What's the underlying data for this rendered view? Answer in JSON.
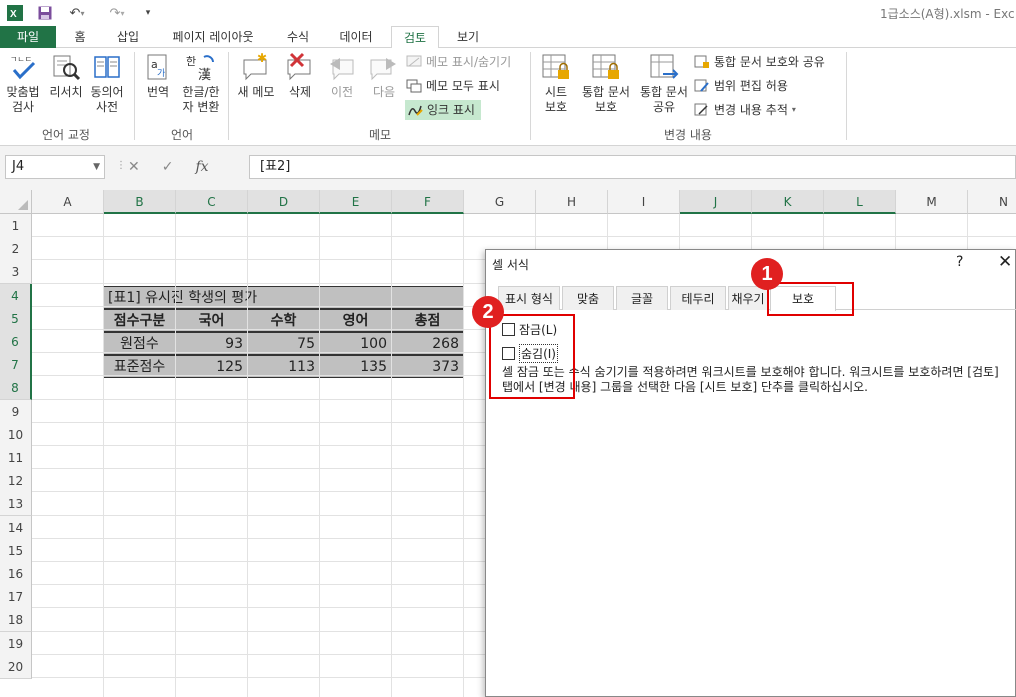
{
  "titlebar": {
    "app_title": "1급소스(A형).xlsm - Exc"
  },
  "tabs": [
    "파일",
    "홈",
    "삽입",
    "페이지 레이아웃",
    "수식",
    "데이터",
    "검토",
    "보기"
  ],
  "ribbon": {
    "language": {
      "spell_1": "맞춤법",
      "spell_2": "검사",
      "research": "리서치",
      "thesaurus_1": "동의어",
      "thesaurus_2": "사전",
      "label": "언어 교정"
    },
    "lang": {
      "translate": "번역",
      "hanja_1": "한글/한",
      "hanja_2": "자 변환",
      "label": "언어"
    },
    "memo": {
      "new": "새 메모",
      "delete": "삭제",
      "prev": "이전",
      "next": "다음",
      "show_hide": "메모 표시/숨기기",
      "show_all": "메모 모두 표시",
      "ink": "잉크 표시",
      "label": "메모"
    },
    "changes": {
      "protect_sheet_1": "시트",
      "protect_sheet_2": "보호",
      "protect_wb_1": "통합 문서",
      "protect_wb_2": "보호",
      "share_wb_1": "통합 문서",
      "share_wb_2": "공유",
      "protect_share": "통합 문서 보호와 공유",
      "allow_edit": "범위 편집 허용",
      "track": "변경 내용 추적",
      "label": "변경 내용"
    }
  },
  "formula_bar": {
    "name_box": "J4",
    "fx": "fx",
    "value": "[표2]"
  },
  "grid": {
    "columns": [
      "A",
      "B",
      "C",
      "D",
      "E",
      "F",
      "G",
      "H",
      "I",
      "J",
      "K",
      "L",
      "M",
      "N"
    ],
    "rows": [
      "1",
      "2",
      "3",
      "4",
      "5",
      "6",
      "7",
      "8",
      "9",
      "10",
      "11",
      "12",
      "13",
      "14",
      "15",
      "16",
      "17",
      "18",
      "19",
      "20"
    ]
  },
  "table": {
    "title": "[표1] 유시진 학생의 평가",
    "headers": [
      "점수구분",
      "국어",
      "수학",
      "영어",
      "총점"
    ],
    "rows": [
      [
        "원점수",
        "93",
        "75",
        "100",
        "268"
      ],
      [
        "표준점수",
        "125",
        "113",
        "135",
        "373"
      ]
    ]
  },
  "dialog": {
    "title": "셀 서식",
    "help": "?",
    "close": "✕",
    "tabs": [
      "표시 형식",
      "맞춤",
      "글꼴",
      "테두리",
      "채우기",
      "보호"
    ],
    "lock_label": "잠금(L)",
    "hide_label": "숨김(I)",
    "note": "셀 잠금 또는 수식 숨기기를 적용하려면 워크시트를 보호해야 합니다. 워크시트를 보호하려면 [검토] 탭에서 [변경 내용] 그룹을 선택한 다음 [시트 보호] 단추를 클릭하십시오."
  },
  "callouts": [
    "1",
    "2"
  ],
  "colors": {
    "excel_green": "#217346",
    "callout_red": "#e02020"
  }
}
